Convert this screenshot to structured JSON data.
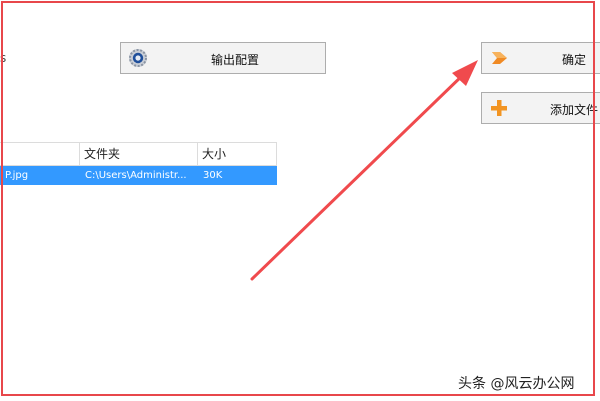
{
  "left_label": "s",
  "toolbar": {
    "config_label": "输出配置",
    "ok_label": "确定",
    "add_label": "添加文件"
  },
  "table": {
    "headers": [
      "",
      "文件夹",
      "大小"
    ],
    "rows": [
      {
        "name": "P.jpg",
        "folder": "C:\\Users\\Administr...",
        "size": "30K"
      }
    ]
  },
  "watermark": "头条 @风云办公网",
  "colors": {
    "frame": "#e8474b",
    "selection": "#3399ff",
    "arrow": "#f04a4d"
  }
}
